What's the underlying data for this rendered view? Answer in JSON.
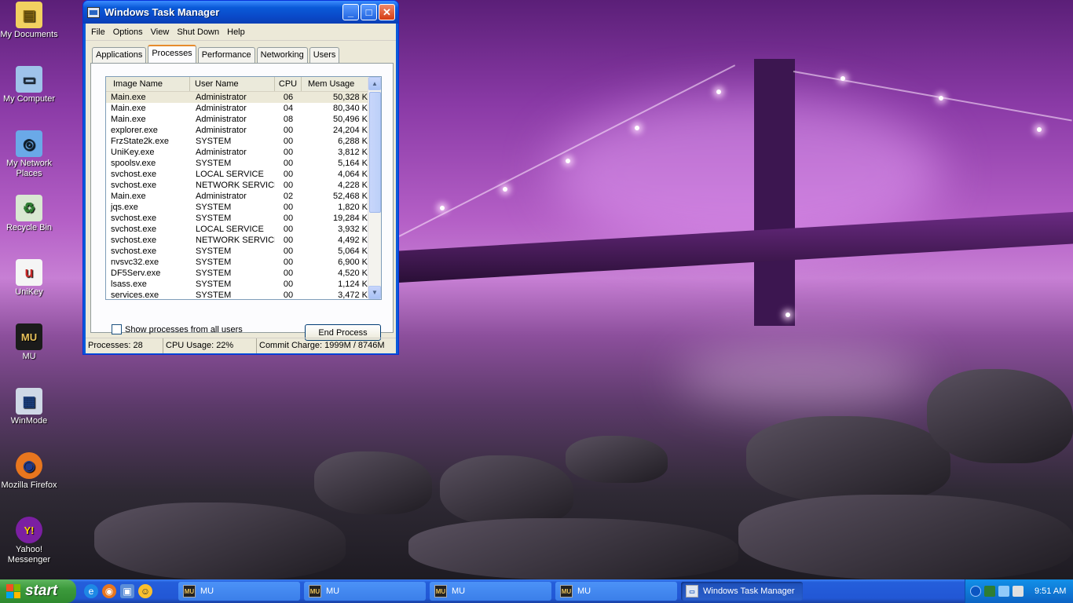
{
  "desktop": {
    "icons": [
      {
        "label": "My Documents",
        "icon": "folder-icon",
        "color": "#f2d160",
        "glyph": "▤"
      },
      {
        "label": "My Computer",
        "icon": "computer-icon",
        "color": "#9fc3ea",
        "glyph": "▭"
      },
      {
        "label": "My Network Places",
        "icon": "network-icon",
        "color": "#6aa9e8",
        "glyph": "◎"
      },
      {
        "label": "Recycle Bin",
        "icon": "recycle-bin-icon",
        "color": "#d9e8d2",
        "glyph": "♻"
      },
      {
        "label": "UniKey",
        "icon": "unikey-icon",
        "color": "#f5f5f5",
        "glyph": "u"
      },
      {
        "label": "MU",
        "icon": "mu-game-icon",
        "color": "#1b1b1b",
        "glyph": "MU"
      },
      {
        "label": "WinMode",
        "icon": "winmode-icon",
        "color": "#cfd8e6",
        "glyph": "▦"
      },
      {
        "label": "Mozilla Firefox",
        "icon": "firefox-icon",
        "color": "#e8761e",
        "glyph": "◉"
      },
      {
        "label": "Yahoo! Messenger",
        "icon": "yahoo-messenger-icon",
        "color": "#7b1fa2",
        "glyph": "Y!"
      }
    ]
  },
  "window": {
    "title": "Windows Task Manager",
    "menu": [
      "File",
      "Options",
      "View",
      "Shut Down",
      "Help"
    ],
    "tabs": [
      "Applications",
      "Processes",
      "Performance",
      "Networking",
      "Users"
    ],
    "active_tab": "Processes",
    "columns": [
      "Image Name",
      "User Name",
      "CPU",
      "Mem Usage"
    ],
    "processes": [
      {
        "name": "Main.exe",
        "user": "Administrator",
        "cpu": "06",
        "mem": "50,328 K"
      },
      {
        "name": "Main.exe",
        "user": "Administrator",
        "cpu": "04",
        "mem": "80,340 K"
      },
      {
        "name": "Main.exe",
        "user": "Administrator",
        "cpu": "08",
        "mem": "50,496 K"
      },
      {
        "name": "explorer.exe",
        "user": "Administrator",
        "cpu": "00",
        "mem": "24,204 K"
      },
      {
        "name": "FrzState2k.exe",
        "user": "SYSTEM",
        "cpu": "00",
        "mem": "6,288 K"
      },
      {
        "name": "UniKey.exe",
        "user": "Administrator",
        "cpu": "00",
        "mem": "3,812 K"
      },
      {
        "name": "spoolsv.exe",
        "user": "SYSTEM",
        "cpu": "00",
        "mem": "5,164 K"
      },
      {
        "name": "svchost.exe",
        "user": "LOCAL SERVICE",
        "cpu": "00",
        "mem": "4,064 K"
      },
      {
        "name": "svchost.exe",
        "user": "NETWORK SERVICE",
        "cpu": "00",
        "mem": "4,228 K"
      },
      {
        "name": "Main.exe",
        "user": "Administrator",
        "cpu": "02",
        "mem": "52,468 K"
      },
      {
        "name": "jqs.exe",
        "user": "SYSTEM",
        "cpu": "00",
        "mem": "1,820 K"
      },
      {
        "name": "svchost.exe",
        "user": "SYSTEM",
        "cpu": "00",
        "mem": "19,284 K"
      },
      {
        "name": "svchost.exe",
        "user": "LOCAL SERVICE",
        "cpu": "00",
        "mem": "3,932 K"
      },
      {
        "name": "svchost.exe",
        "user": "NETWORK SERVICE",
        "cpu": "00",
        "mem": "4,492 K"
      },
      {
        "name": "svchost.exe",
        "user": "SYSTEM",
        "cpu": "00",
        "mem": "5,064 K"
      },
      {
        "name": "nvsvc32.exe",
        "user": "SYSTEM",
        "cpu": "00",
        "mem": "6,900 K"
      },
      {
        "name": "DF5Serv.exe",
        "user": "SYSTEM",
        "cpu": "00",
        "mem": "4,520 K"
      },
      {
        "name": "lsass.exe",
        "user": "SYSTEM",
        "cpu": "00",
        "mem": "1,124 K"
      },
      {
        "name": "services.exe",
        "user": "SYSTEM",
        "cpu": "00",
        "mem": "3,472 K"
      }
    ],
    "show_all_label": "Show processes from all users",
    "end_process_label": "End Process",
    "status": {
      "processes": "Processes: 28",
      "cpu": "CPU Usage: 22%",
      "commit": "Commit Charge: 1999M / 8746M"
    }
  },
  "taskbar": {
    "start_label": "start",
    "quick_launch": [
      "internet-explorer-icon",
      "firefox-icon",
      "desktop-icon",
      "yahoo-messenger-icon"
    ],
    "tasks": [
      {
        "label": "MU",
        "active": false
      },
      {
        "label": "MU",
        "active": false
      },
      {
        "label": "MU",
        "active": false
      },
      {
        "label": "MU",
        "active": false
      },
      {
        "label": "Windows Task Manager",
        "active": true
      }
    ],
    "clock": "9:51 AM"
  },
  "colors": {
    "selection_orange": "#e68b2c",
    "xp_blue": "#245edb",
    "start_green": "#3c9a3c"
  }
}
